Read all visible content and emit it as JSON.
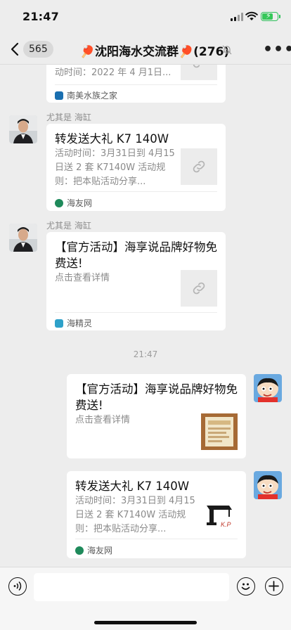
{
  "status_bar": {
    "time": "21:47"
  },
  "nav": {
    "unread_count": "565",
    "title": "沈阳海水交流群",
    "member_count": "(276)",
    "more_label": "•••"
  },
  "messages": [
    {
      "type": "partial-card",
      "desc": "动时间：2022 年 4 月1日...",
      "source": "南美水族之家"
    },
    {
      "sender": "尤其是 海缸",
      "title": "转发送大礼 K7 140W",
      "desc": "活动时间：3月31日到 4月15日送 2 套 K7140W 活动规则：把本贴活动分享...",
      "source": "海友网"
    },
    {
      "sender": "尤其是 海缸",
      "title": "【官方活动】海享说品牌好物免费送!",
      "desc": "点击查看详情",
      "source": "海精灵"
    },
    {
      "timestamp": "21:47"
    },
    {
      "title": "【官方活动】海享说品牌好物免费送!",
      "desc": "点击查看详情"
    },
    {
      "title": "转发送大礼 K7 140W",
      "desc": "活动时间：3月31日到 4月15日送 2 套 K7140W 活动规则：把本贴活动分享...",
      "source": "海友网"
    }
  ],
  "colors": {
    "background": "#ededed",
    "card": "#ffffff",
    "accent_red": "#e4402f",
    "battery_green": "#35c759"
  },
  "battery_level": 0.8,
  "icons": [
    "back-arrow-icon",
    "mute-bell-icon",
    "more-icon",
    "link-icon",
    "voice-icon",
    "emoji-icon",
    "plus-icon"
  ]
}
